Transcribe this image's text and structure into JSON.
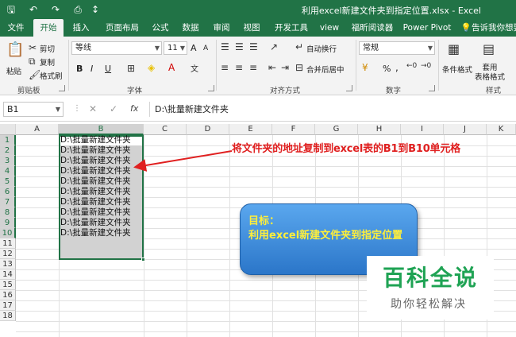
{
  "titlebar": {
    "title": "利用excel新建文件夹到指定位置.xlsx  -  Excel",
    "qa_icons": [
      "save-icon",
      "undo-icon",
      "redo-icon",
      "print-preview-icon",
      "sort-icon"
    ],
    "qa_glyphs": {
      "save": "🖫",
      "undo": "↶",
      "redo": "↷",
      "print": "⎙",
      "sort": "↕"
    }
  },
  "tabs": [
    {
      "label": "文件"
    },
    {
      "label": "开始"
    },
    {
      "label": "插入"
    },
    {
      "label": "页面布局"
    },
    {
      "label": "公式"
    },
    {
      "label": "数据"
    },
    {
      "label": "审阅"
    },
    {
      "label": "视图"
    },
    {
      "label": "开发工具"
    },
    {
      "label": "view"
    },
    {
      "label": "福昕阅读器"
    },
    {
      "label": "Power Pivot"
    },
    {
      "label": "告诉我你想要"
    }
  ],
  "active_tab": "开始",
  "ribbon": {
    "clipboard": {
      "paste": "粘贴",
      "cut": "剪切",
      "copy": "复制",
      "format_painter": "格式刷",
      "label": "剪贴板"
    },
    "font": {
      "name": "等线",
      "size": "11",
      "label": "字体",
      "bold": "B",
      "italic": "I",
      "underline": "U",
      "grow": "A",
      "shrink": "A"
    },
    "alignment": {
      "wrap": "自动换行",
      "merge": "合并后居中",
      "label": "对齐方式"
    },
    "number": {
      "format": "常规",
      "label": "数字",
      "percent": "%",
      "comma": ","
    },
    "styles": {
      "conditional": "条件格式",
      "table": "套用\n表格格式",
      "label": "样式"
    }
  },
  "formula_bar": {
    "name_box": "B1",
    "cancel": "✕",
    "enter": "✓",
    "fx": "fx",
    "content": "D:\\批量新建文件夹"
  },
  "grid": {
    "columns": [
      "A",
      "B",
      "C",
      "D",
      "E",
      "F",
      "G",
      "H",
      "I",
      "J",
      "K"
    ],
    "rows": [
      "1",
      "2",
      "3",
      "4",
      "5",
      "6",
      "7",
      "8",
      "9",
      "10",
      "11",
      "12",
      "13",
      "14",
      "15",
      "16",
      "17",
      "18"
    ],
    "selected_column": "B",
    "selected_rows": [
      "1",
      "2",
      "3",
      "4",
      "5",
      "6",
      "7",
      "8",
      "9",
      "10"
    ],
    "b_values": [
      "D:\\批量新建文件夹",
      "D:\\批量新建文件夹",
      "D:\\批量新建文件夹",
      "D:\\批量新建文件夹",
      "D:\\批量新建文件夹",
      "D:\\批量新建文件夹",
      "D:\\批量新建文件夹",
      "D:\\批量新建文件夹",
      "D:\\批量新建文件夹",
      "D:\\批量新建文件夹"
    ]
  },
  "annotations": {
    "instruction": "将文件夹的地址复制到excel表的B1到B10单元格",
    "callout_title": "目标：",
    "callout_body": "利用excel新建文件夹到指定位置"
  },
  "watermark": {
    "name": "百科全说",
    "slogan": "助你轻松解决"
  },
  "colors": {
    "excel_green": "#217346",
    "annotation_red": "#e02020",
    "callout_blue": "#2b76c9",
    "callout_text": "#ffef3a",
    "watermark_green": "#1fa354"
  }
}
